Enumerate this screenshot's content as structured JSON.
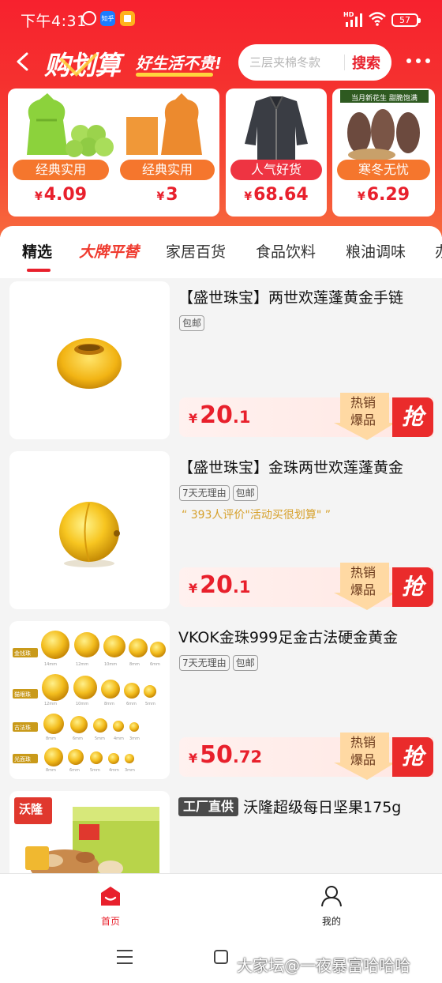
{
  "status_bar": {
    "time": "下午4:31",
    "app1_label": "知乎",
    "network": "HD",
    "battery": "57"
  },
  "header": {
    "logo": "购划算",
    "slogan": "好生活不贵!",
    "search_placeholder": "三层夹棉冬款",
    "search_button": "搜索",
    "colors": {
      "brand_red": "#e8202c",
      "header_gradient_top": "#f7212e",
      "header_gradient_bottom": "#f76a3d"
    }
  },
  "promos": [
    {
      "image": "garbage-bags-image",
      "tag": "经典实用",
      "currency": "¥",
      "price": "4.09",
      "tag_color": "#f5762d"
    },
    {
      "image": "tissue-boxes-image",
      "tag": "经典实用",
      "currency": "¥",
      "price": "3",
      "tag_color": "#f5762d"
    },
    {
      "image": "winter-jacket-image",
      "tag": "人气好货",
      "currency": "¥",
      "price": "68.64",
      "tag_color": "#ee3442"
    },
    {
      "image": "peanuts-image",
      "image_caption": "当月新花生 甜脆饱满",
      "tag": "寒冬无忧",
      "currency": "¥",
      "price": "6.29",
      "tag_color": "#f5762d"
    }
  ],
  "tabs": [
    "精选",
    "大牌平替",
    "家居百货",
    "食品饮料",
    "粮油调味",
    "办"
  ],
  "products": [
    {
      "image": "gold-bead-ring-image",
      "title": "【盛世珠宝】两世欢莲蓬黄金手链",
      "badges": [
        "包邮"
      ],
      "review": "",
      "currency": "¥",
      "price_int": "20",
      "price_dec": ".1",
      "hot_line1": "热销",
      "hot_line2": "爆品",
      "grab": "抢"
    },
    {
      "image": "gold-bead-ball-image",
      "title": "【盛世珠宝】金珠两世欢莲蓬黄金",
      "badges": [
        "7天无理由",
        "包邮"
      ],
      "review": "“ 393人评价\"活动买很划算\" ”",
      "currency": "¥",
      "price_int": "20",
      "price_dec": ".1",
      "hot_line1": "热销",
      "hot_line2": "爆品",
      "grab": "抢"
    },
    {
      "image": "gold-bead-sizes-chart-image",
      "image_labels": [
        "金钱珠",
        "猫眼珠",
        "古法珠",
        "光面珠"
      ],
      "title": "VKOK金珠999足金古法硬金黄金",
      "badges": [
        "7天无理由",
        "包邮"
      ],
      "review": "",
      "currency": "¥",
      "price_int": "50",
      "price_dec": ".72",
      "hot_line1": "热销",
      "hot_line2": "爆品",
      "grab": "抢"
    },
    {
      "image": "mixed-nuts-box-image",
      "image_brand": "沃隆",
      "factory_tag": "工厂直供",
      "title": "沃隆超级每日坚果175g",
      "badges": [],
      "review": ""
    }
  ],
  "bottom_nav": [
    {
      "label": "首页",
      "icon": "home-icon",
      "active": true
    },
    {
      "label": "我的",
      "icon": "user-icon",
      "active": false
    }
  ],
  "watermark": "大家坛@一夜暴富哈哈哈"
}
